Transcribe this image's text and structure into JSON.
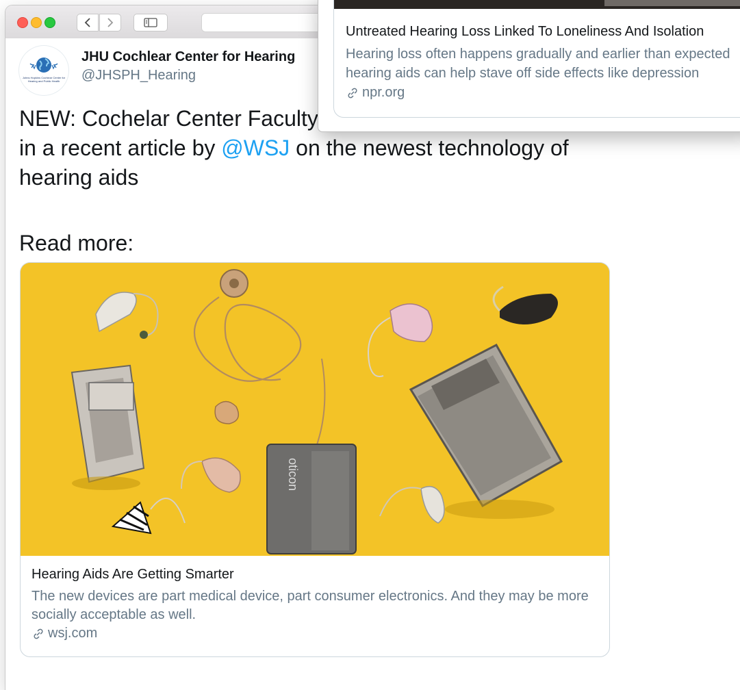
{
  "window": {
    "nav": {
      "back_icon": "chevron-left-icon",
      "forward_icon": "chevron-right-icon",
      "sidebar_icon": "sidebar-icon"
    }
  },
  "tweet": {
    "avatar_caption": "Johns Hopkins Cochlear Center for Hearing and Public Health",
    "display_name": "JHU Cochlear Center for Hearing",
    "handle": "@JHSPH_Hearing",
    "text_before": "NEW: Cochelar Center Faculty ",
    "text_hidden": "",
    "text_line1_tail": "in a recent article by ",
    "mention": "@WSJ",
    "text_after": " on the newest technology of hearing aids",
    "read_more": "Read more:"
  },
  "card": {
    "title": "Hearing Aids Are Getting Smarter",
    "description": "The new devices are part medical device, part consumer electronics. And they may be more socially acceptable as well.",
    "link_icon": "link-icon",
    "domain": "wsj.com",
    "image_bg": "#f2c22a",
    "device_label": "oticon"
  },
  "overlay_card": {
    "title": "Untreated Hearing Loss Linked To Loneliness And Isolation",
    "description_line1": "Hearing loss often happens gradually and earlier than expected",
    "description_line2": "hearing aids can help stave off side effects like depression",
    "link_icon": "link-icon",
    "domain": "npr.org"
  },
  "colors": {
    "mention": "#1da1f2",
    "secondary_text": "#657786",
    "card_border": "#ccd6dd"
  }
}
